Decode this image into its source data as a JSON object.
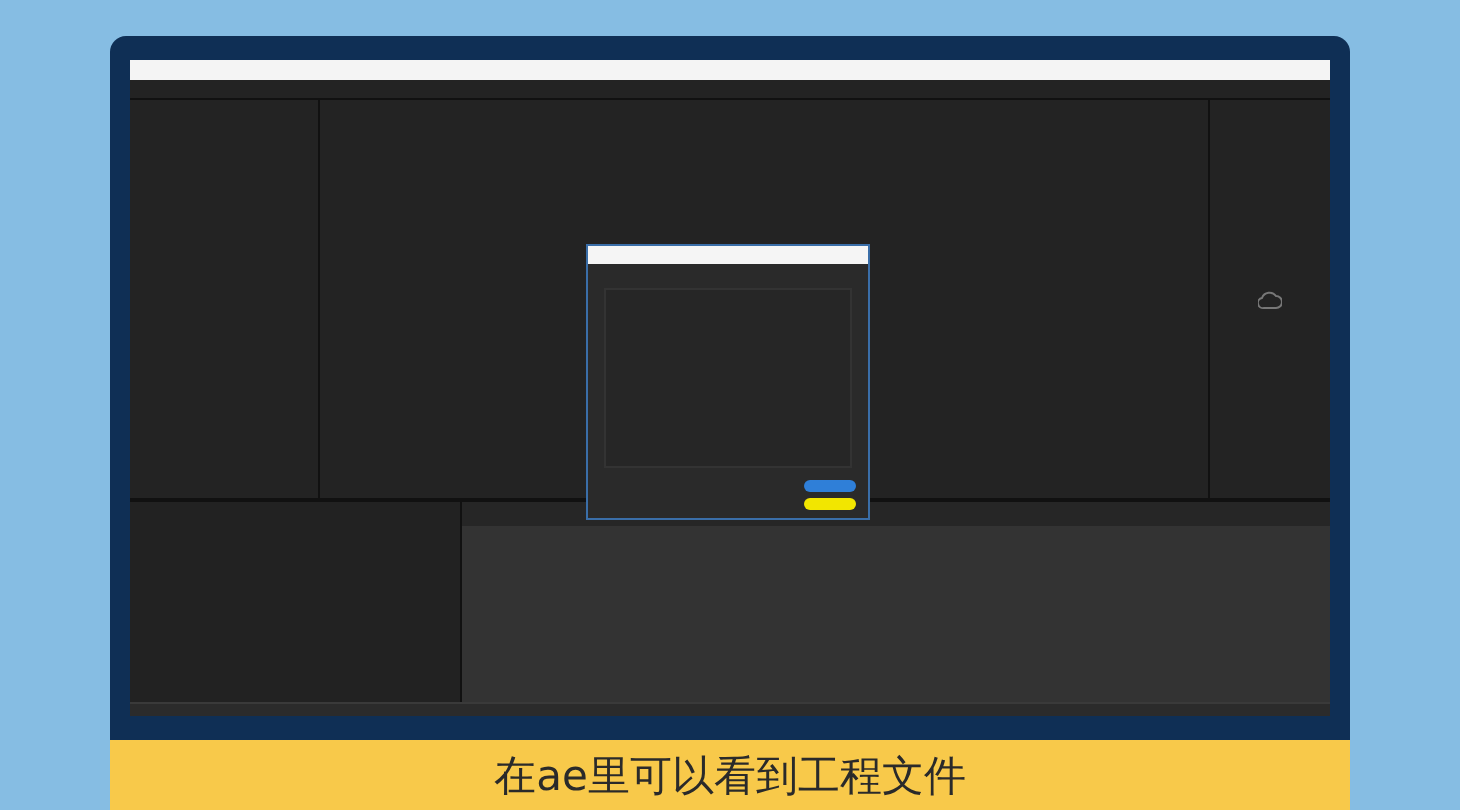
{
  "subtitle": {
    "text": "在ae里可以看到工程文件"
  },
  "dialog": {
    "buttons": [
      {
        "color": "#2f7fd8"
      },
      {
        "color": "#f2e600"
      }
    ]
  }
}
